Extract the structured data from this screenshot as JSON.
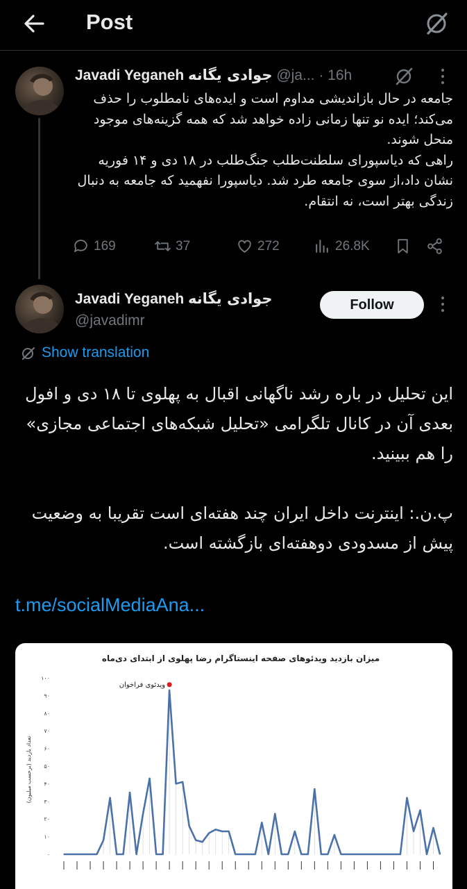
{
  "header": {
    "title": "Post"
  },
  "tweet1": {
    "name": "Javadi Yeganeh",
    "name_fa": "جوادی یگانه",
    "handle": "@ja...",
    "time": "· 16h",
    "text": "جامعه در حال بازاندیشی مداوم است و ایده‌های نامطلوب را حذف می‌کند؛ ایده نو تنها زمانی زاده خواهد شد که همه گزینه‌های موجود منحل شوند.\nراهی که دیاسپورای سلطنت‌طلب جنگ‌طلب در ۱۸ دی و ۱۴ فوریه نشان داد،از سوی جامعه طرد شد. دیاسپورا نفهمید که جامعه به دنبال زندگی بهتر است، نه انتقام.",
    "stats": {
      "replies": "169",
      "reposts": "37",
      "likes": "272",
      "views": "26.8K"
    }
  },
  "tweet2": {
    "name": "Javadi Yeganeh",
    "name_fa": "جوادی یگانه",
    "handle": "@javadimr",
    "follow_label": "Follow",
    "translate_label": "Show translation",
    "text": "این تحلیل در باره رشد ناگهانی اقبال به پهلوی تا ۱۸ دی و افول بعدی آن در کانال تلگرامی «تحلیل شبکه‌های اجتماعی مجازی» را هم ببینید.\n\nپ.ن.: اینترنت داخل ایران چند هفته‌ای است تقریبا به وضعیت پیش از مسدودی دوهفته‌ای بازگشته است.",
    "link": "t.me/socialMediaAna..."
  },
  "chart_data": {
    "type": "line",
    "title": "میزان بازدید ویدئوهای صفحه اینستاگرام رضا پهلوی از ابتدای دی‌ماه",
    "ylabel": "تعداد بازدید (برحسب میلیون)",
    "yticks": [
      "۰",
      "۱۰",
      "۲۰",
      "۳۰",
      "۴۰",
      "۵۰",
      "۶۰",
      "۷۰",
      "۸۰",
      "۹۰",
      "۱۰۰"
    ],
    "ylim": [
      0,
      100
    ],
    "annotation": "ویدئوی فراخوان",
    "color": "#4a72a8",
    "values": [
      0,
      0,
      0,
      0,
      0,
      0,
      8,
      32,
      0,
      0,
      35,
      0,
      23,
      43,
      0,
      0,
      93,
      40,
      41,
      16,
      8,
      7,
      12,
      14,
      13,
      13,
      0,
      0,
      0,
      0,
      18,
      0,
      23,
      0,
      0,
      13,
      0,
      0,
      37,
      0,
      0,
      11,
      0,
      0,
      0,
      0,
      0,
      0,
      0,
      0,
      0,
      0,
      32,
      13,
      25,
      0,
      15,
      0
    ]
  }
}
